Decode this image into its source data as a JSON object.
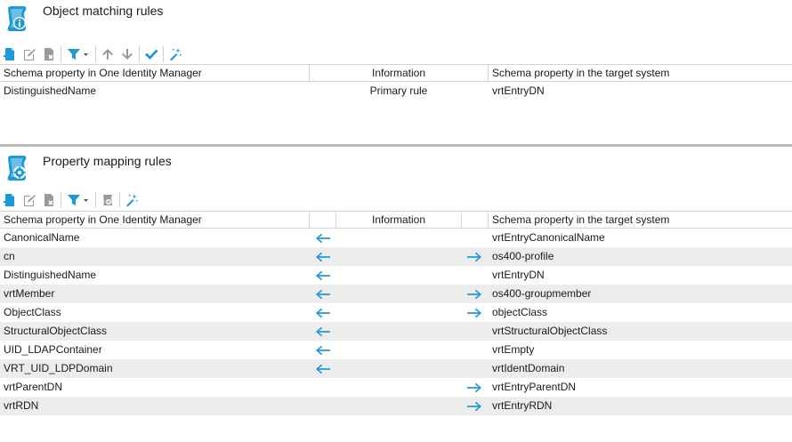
{
  "object_matching": {
    "title": "Object matching rules",
    "columns": [
      "Schema property in One Identity Manager",
      "Information",
      "Schema property in the target system"
    ],
    "rows": [
      {
        "left": "DistinguishedName",
        "info": "Primary rule",
        "right": "vrtEntryDN"
      }
    ]
  },
  "property_mapping": {
    "title": "Property mapping rules",
    "columns": [
      "Schema property in One Identity Manager",
      "Information",
      "Schema property in the target system"
    ],
    "rows": [
      {
        "left": "CanonicalName",
        "arrow_left": true,
        "arrow_right": false,
        "info": "",
        "right": "vrtEntryCanonicalName"
      },
      {
        "left": "cn",
        "arrow_left": true,
        "arrow_right": true,
        "info": "",
        "right": "os400-profile"
      },
      {
        "left": "DistinguishedName",
        "arrow_left": true,
        "arrow_right": false,
        "info": "",
        "right": "vrtEntryDN"
      },
      {
        "left": "vrtMember",
        "arrow_left": true,
        "arrow_right": true,
        "info": "",
        "right": "os400-groupmember"
      },
      {
        "left": "ObjectClass",
        "arrow_left": true,
        "arrow_right": true,
        "info": "",
        "right": "objectClass"
      },
      {
        "left": "StructuralObjectClass",
        "arrow_left": true,
        "arrow_right": false,
        "info": "",
        "right": "vrtStructuralObjectClass"
      },
      {
        "left": "UID_LDAPContainer",
        "arrow_left": true,
        "arrow_right": false,
        "info": "",
        "right": "vrtEmpty"
      },
      {
        "left": "VRT_UID_LDPDomain",
        "arrow_left": true,
        "arrow_right": false,
        "info": "",
        "right": "vrtIdentDomain"
      },
      {
        "left": "vrtParentDN",
        "arrow_left": false,
        "arrow_right": true,
        "info": "",
        "right": "vrtEntryParentDN"
      },
      {
        "left": "vrtRDN",
        "arrow_left": false,
        "arrow_right": true,
        "info": "",
        "right": "vrtEntryRDN"
      }
    ]
  },
  "colors": {
    "accent": "#1e9ad6",
    "alt_row": "#ececec",
    "grid_line": "#d4d4d4",
    "splitter": "#b9b9b9"
  }
}
